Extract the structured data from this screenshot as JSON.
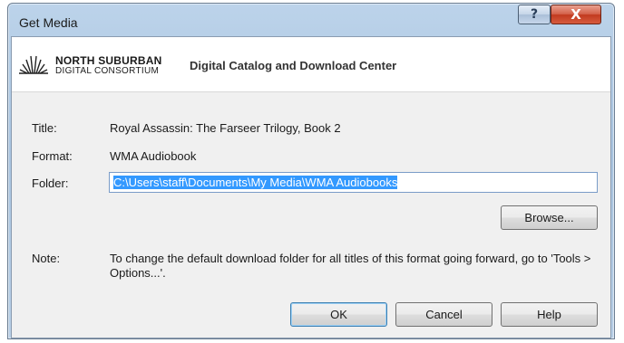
{
  "window": {
    "title": "Get Media",
    "help_label": "?",
    "close_label": "X"
  },
  "banner": {
    "logo_line1": "NORTH SUBURBAN",
    "logo_line2": "DIGITAL CONSORTIUM",
    "heading": "Digital Catalog and Download Center"
  },
  "fields": {
    "title_label": "Title:",
    "title_value": "Royal Assassin: The Farseer Trilogy, Book 2",
    "format_label": "Format:",
    "format_value": "WMA Audiobook",
    "folder_label": "Folder:",
    "folder_value": "C:\\Users\\staff\\Documents\\My Media\\WMA Audiobooks",
    "note_label": "Note:",
    "note_value": "To change the default download folder for all titles of this format going forward, go to 'Tools > Options...'."
  },
  "buttons": {
    "browse": "Browse...",
    "ok": "OK",
    "cancel": "Cancel",
    "help": "Help"
  },
  "colors": {
    "selection": "#3399ff",
    "close_button": "#c23a1f",
    "frame": "#a9c4e0"
  }
}
